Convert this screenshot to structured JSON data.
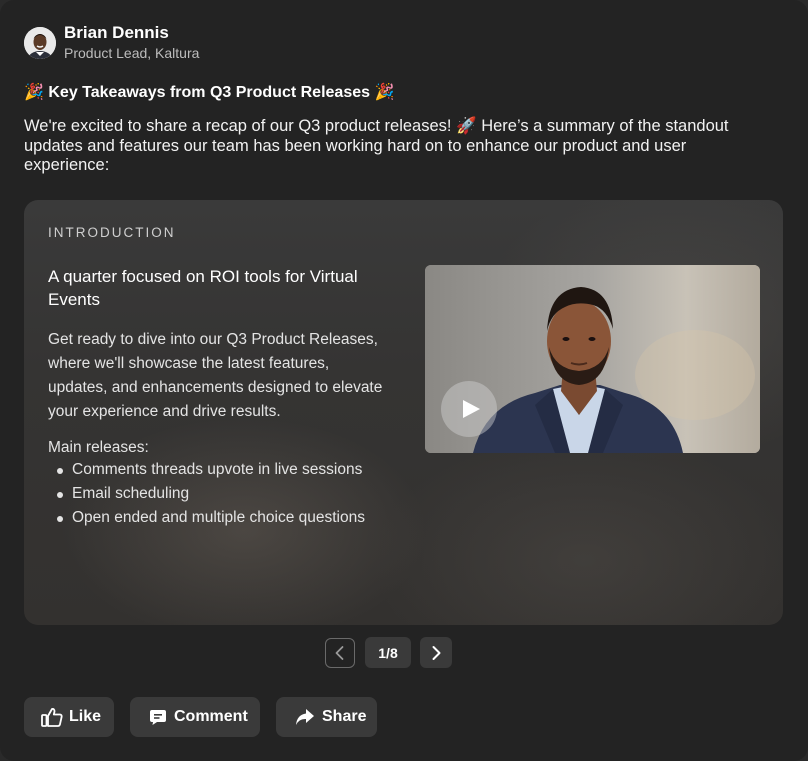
{
  "author": {
    "name": "Brian Dennis",
    "role": "Product Lead, Kaltura"
  },
  "post": {
    "headline": "Key Takeaways from Q3 Product Releases",
    "headline_emoji": "🎉",
    "intro": "We're excited to share a recap of our Q3 product releases! 🚀 Here’s a summary of the standout updates and features our team has been working hard on to enhance our product and user experience:"
  },
  "slide": {
    "kicker": "INTRODUCTION",
    "title": "A quarter focused on ROI tools for Virtual Events",
    "body": "Get ready to dive into our Q3 Product Releases, where we'll showcase the latest features, updates, and enhancements designed to elevate your experience and drive results.",
    "list_label": "Main releases:",
    "items": [
      "Comments threads upvote in live sessions",
      "Email scheduling",
      "Open ended and multiple choice questions"
    ],
    "video_icon": "play-icon"
  },
  "pager": {
    "label": "1/8",
    "current": 1,
    "total": 8
  },
  "actions": {
    "like": "Like",
    "comment": "Comment",
    "share": "Share"
  },
  "colors": {
    "card_bg": "#232323",
    "slide_bg": "#383736",
    "button_bg": "#3a3a3a",
    "text": "#ffffff",
    "muted_text": "#bdbdbd"
  }
}
